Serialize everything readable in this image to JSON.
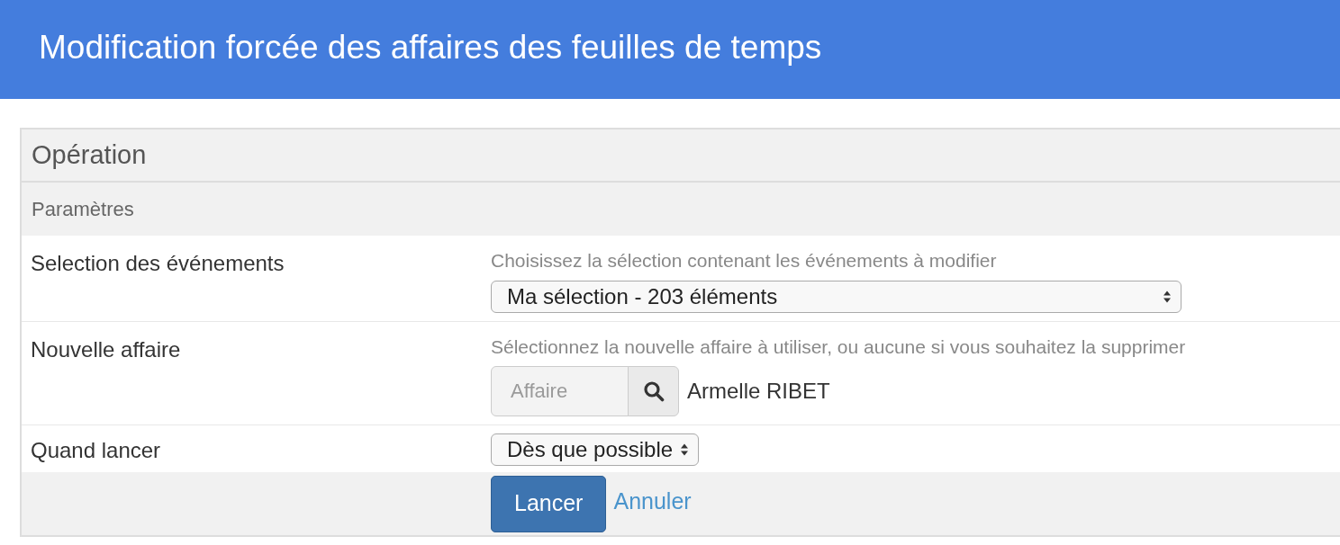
{
  "header": {
    "title": "Modification forcée des affaires des feuilles de temps"
  },
  "panel": {
    "title": "Opération",
    "subtitle": "Paramètres",
    "fields": [
      {
        "kind": "select",
        "label": "Selection des événements",
        "help": "Choisissez la sélection contenant les événements à modifier",
        "value": "Ma sélection - 203 éléments",
        "wide": true
      },
      {
        "kind": "lookup",
        "label": "Nouvelle affaire",
        "help": "Sélectionnez la nouvelle affaire à utiliser, ou aucune si vous souhaitez la supprimer",
        "placeholder": "Affaire",
        "value": "Armelle RIBET"
      },
      {
        "kind": "select",
        "label": "Quand lancer",
        "value": "Dès que possible",
        "wide": false
      }
    ],
    "actions": {
      "submit": "Lancer",
      "cancel": "Annuler"
    }
  }
}
